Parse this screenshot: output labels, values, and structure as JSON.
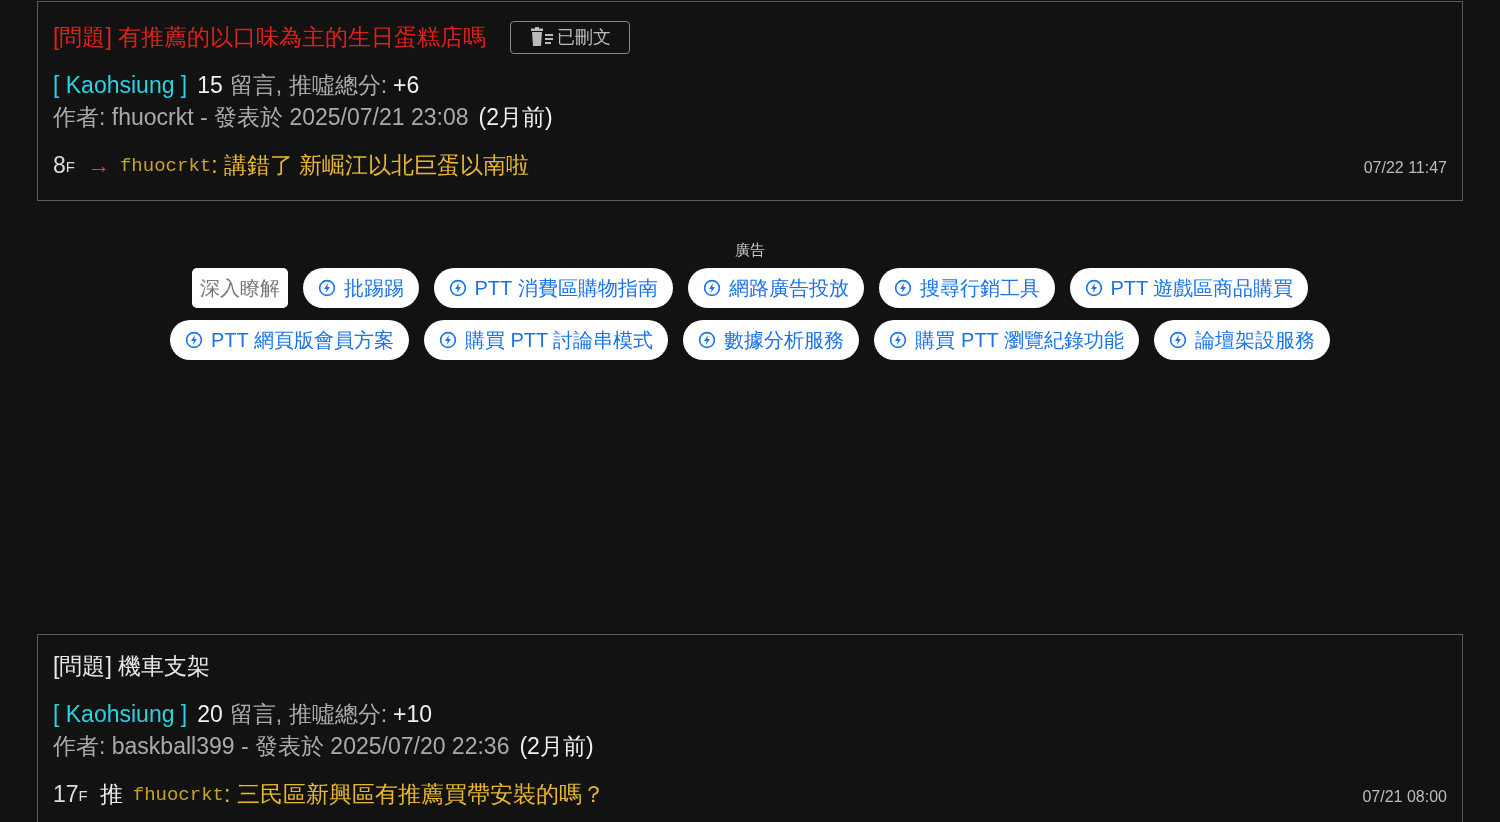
{
  "posts": [
    {
      "title": "[問題] 有推薦的以口味為主的生日蛋糕店嗎",
      "deleted": true,
      "deleted_label": "已刪文",
      "board": "[ Kaohsiung ]",
      "comment_count": "15",
      "comments_label": "留言, 推噓總分:",
      "score": "+6",
      "author_line": "作者: fhuocrkt - 發表於 2025/07/21 23:08",
      "ago": "(2月前)",
      "comment": {
        "floor": "8",
        "floor_unit": "F",
        "kind": "arrow",
        "tag": "→",
        "user": "fhuocrkt",
        "text": ": 講錯了 新崛江以北巨蛋以南啦",
        "time": "07/22 11:47"
      }
    },
    {
      "title": "[問題] 機車支架",
      "deleted": false,
      "board": "[ Kaohsiung ]",
      "comment_count": "20",
      "comments_label": "留言, 推噓總分:",
      "score": "+10",
      "author_line": "作者: baskball399 - 發表於 2025/07/20 22:36",
      "ago": "(2月前)",
      "comment": {
        "floor": "17",
        "floor_unit": "F",
        "kind": "push",
        "tag": "推",
        "user": "fhuocrkt",
        "text": ": 三民區新興區有推薦買帶安裝的嗎？",
        "time": "07/21 08:00"
      }
    }
  ],
  "ads": {
    "label": "廣告",
    "items": [
      {
        "kind": "link",
        "label": "深入瞭解"
      },
      {
        "kind": "chip",
        "label": "批踢踢"
      },
      {
        "kind": "chip",
        "label": "PTT 消費區購物指南"
      },
      {
        "kind": "chip",
        "label": "網路廣告投放"
      },
      {
        "kind": "chip",
        "label": "搜尋行銷工具"
      },
      {
        "kind": "chip",
        "label": "PTT 遊戲區商品購買"
      },
      {
        "kind": "chip",
        "label": "PTT 網頁版會員方案"
      },
      {
        "kind": "chip",
        "label": "購買 PTT 討論串模式"
      },
      {
        "kind": "chip",
        "label": "數據分析服務"
      },
      {
        "kind": "chip",
        "label": "購買 PTT 瀏覽紀錄功能"
      },
      {
        "kind": "chip",
        "label": "論壇架設服務"
      }
    ]
  }
}
